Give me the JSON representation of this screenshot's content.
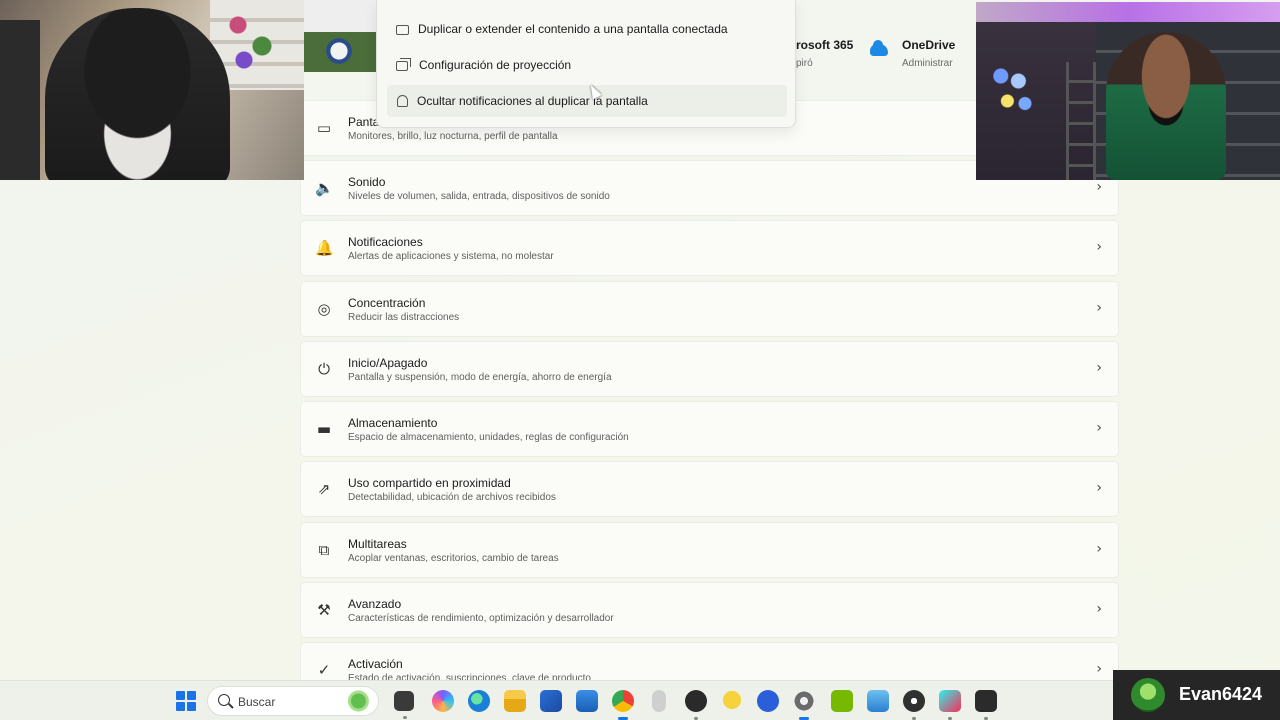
{
  "flyout": {
    "items": [
      {
        "label": "Duplicar o extender el contenido a una pantalla conectada",
        "icon": "monitor-icon"
      },
      {
        "label": "Configuración de proyección",
        "icon": "project-icon"
      },
      {
        "label": "Ocultar notificaciones al duplicar la pantalla",
        "icon": "bell-icon"
      }
    ]
  },
  "header": {
    "m365_title": "rosoft 365",
    "m365_sub": "piró",
    "onedrive_title": "OneDrive",
    "onedrive_sub": "Administrar"
  },
  "settings": [
    {
      "title": "Panta",
      "subtitle": "Monitores, brillo, luz nocturna, perfil de pantalla",
      "icon": "display-icon"
    },
    {
      "title": "Sonido",
      "subtitle": "Niveles de volumen, salida, entrada, dispositivos de sonido",
      "icon": "speaker-icon"
    },
    {
      "title": "Notificaciones",
      "subtitle": "Alertas de aplicaciones y sistema, no molestar",
      "icon": "bell-icon"
    },
    {
      "title": "Concentración",
      "subtitle": "Reducir las distracciones",
      "icon": "focus-icon"
    },
    {
      "title": "Inicio/Apagado",
      "subtitle": "Pantalla y suspensión, modo de energía, ahorro de energía",
      "icon": "power-icon"
    },
    {
      "title": "Almacenamiento",
      "subtitle": "Espacio de almacenamiento, unidades, reglas de configuración",
      "icon": "storage-icon"
    },
    {
      "title": "Uso compartido en proximidad",
      "subtitle": "Detectabilidad, ubicación de archivos recibidos",
      "icon": "share-icon"
    },
    {
      "title": "Multitareas",
      "subtitle": "Acoplar ventanas, escritorios, cambio de tareas",
      "icon": "multitask-icon"
    },
    {
      "title": "Avanzado",
      "subtitle": "Características de rendimiento, optimización y desarrollador",
      "icon": "tools-icon"
    },
    {
      "title": "Activación",
      "subtitle": "Estado de activación, suscripciones, clave de producto",
      "icon": "check-circle-icon"
    }
  ],
  "taskbar": {
    "search_label": "Buscar",
    "apps": [
      "file-explorer-dark-icon",
      "copilot-icon",
      "edge-icon",
      "file-explorer-icon",
      "store-icon",
      "mail-icon",
      "chrome-icon",
      "mouse-icon",
      "bm-app-icon",
      "duck-icon",
      "vpn-icon",
      "settings-icon",
      "nvidia-icon",
      "photos-icon",
      "obs-icon",
      "tiktok-icon",
      "epic-games-icon"
    ]
  },
  "streamer": {
    "name": "Evan6424"
  }
}
